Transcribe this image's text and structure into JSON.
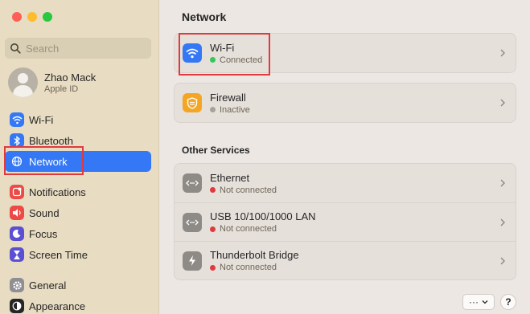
{
  "window": {
    "title": "Network"
  },
  "search": {
    "placeholder": "Search"
  },
  "profile": {
    "name": "Zhao Mack",
    "subtitle": "Apple ID"
  },
  "sidebar": {
    "items": [
      {
        "label": "Wi-Fi",
        "icon": "wifi-icon",
        "color": "#3478f6"
      },
      {
        "label": "Bluetooth",
        "icon": "bluetooth-icon",
        "color": "#3478f6"
      },
      {
        "label": "Network",
        "icon": "globe-icon",
        "color": "#3478f6",
        "selected": true
      },
      {
        "label": "Notifications",
        "icon": "bell-icon",
        "color": "#ee4a45"
      },
      {
        "label": "Sound",
        "icon": "speaker-icon",
        "color": "#ee4a45"
      },
      {
        "label": "Focus",
        "icon": "moon-icon",
        "color": "#5b4fd3"
      },
      {
        "label": "Screen Time",
        "icon": "hourglass-icon",
        "color": "#5b4fd3"
      },
      {
        "label": "General",
        "icon": "gear-icon",
        "color": "#8e8e93"
      },
      {
        "label": "Appearance",
        "icon": "appearance-icon",
        "color": "#262626"
      }
    ]
  },
  "main": {
    "title": "Network",
    "services": [
      {
        "name": "Wi-Fi",
        "status": "Connected",
        "status_color": "#34c759",
        "icon": "wifi-icon",
        "icon_color": "#3478f6"
      },
      {
        "name": "Firewall",
        "status": "Inactive",
        "status_color": "#a8a29c",
        "icon": "firewall-icon",
        "icon_color": "#f5a524"
      }
    ],
    "other_section": "Other Services",
    "other_services": [
      {
        "name": "Ethernet",
        "status": "Not connected",
        "status_color": "#e0393e",
        "icon": "ethernet-icon"
      },
      {
        "name": "USB 10/100/1000 LAN",
        "status": "Not connected",
        "status_color": "#e0393e",
        "icon": "ethernet-icon"
      },
      {
        "name": "Thunderbolt Bridge",
        "status": "Not connected",
        "status_color": "#e0393e",
        "icon": "thunderbolt-icon"
      }
    ],
    "more_button": "···",
    "help_button": "?"
  }
}
